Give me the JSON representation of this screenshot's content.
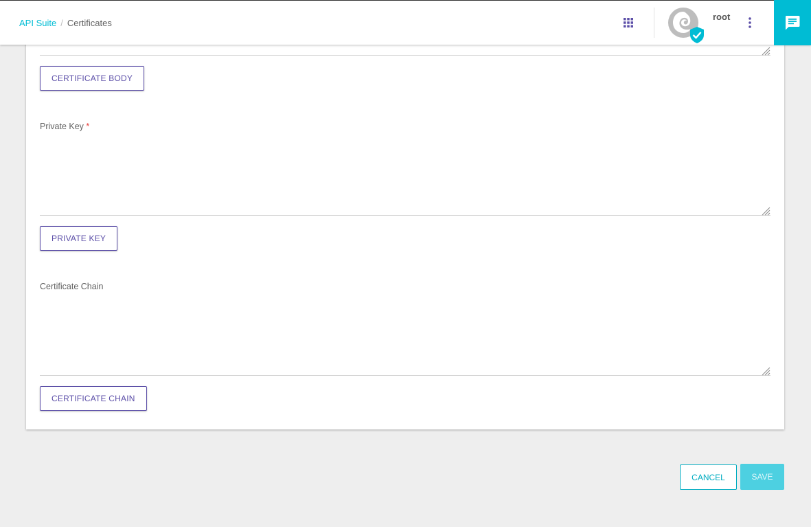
{
  "breadcrumb": {
    "root": "API Suite",
    "current": "Certificates"
  },
  "header": {
    "username": "root",
    "apps_icon": "apps-grid-icon",
    "more_icon": "more-vert-icon",
    "chat_icon": "chat-icon"
  },
  "form": {
    "certificate_body_button": "CERTIFICATE BODY",
    "private_key": {
      "label": "Private Key",
      "required_mark": "*",
      "value": "",
      "button": "PRIVATE KEY"
    },
    "certificate_chain": {
      "label": "Certificate Chain",
      "value": "",
      "button": "CERTIFICATE CHAIN"
    }
  },
  "actions": {
    "cancel": "CANCEL",
    "save": "SAVE"
  },
  "colors": {
    "accent": "#00bcd4",
    "primary": "#5c4fa8",
    "save_disabled": "#4dd0e1",
    "background": "#eeeeee"
  }
}
